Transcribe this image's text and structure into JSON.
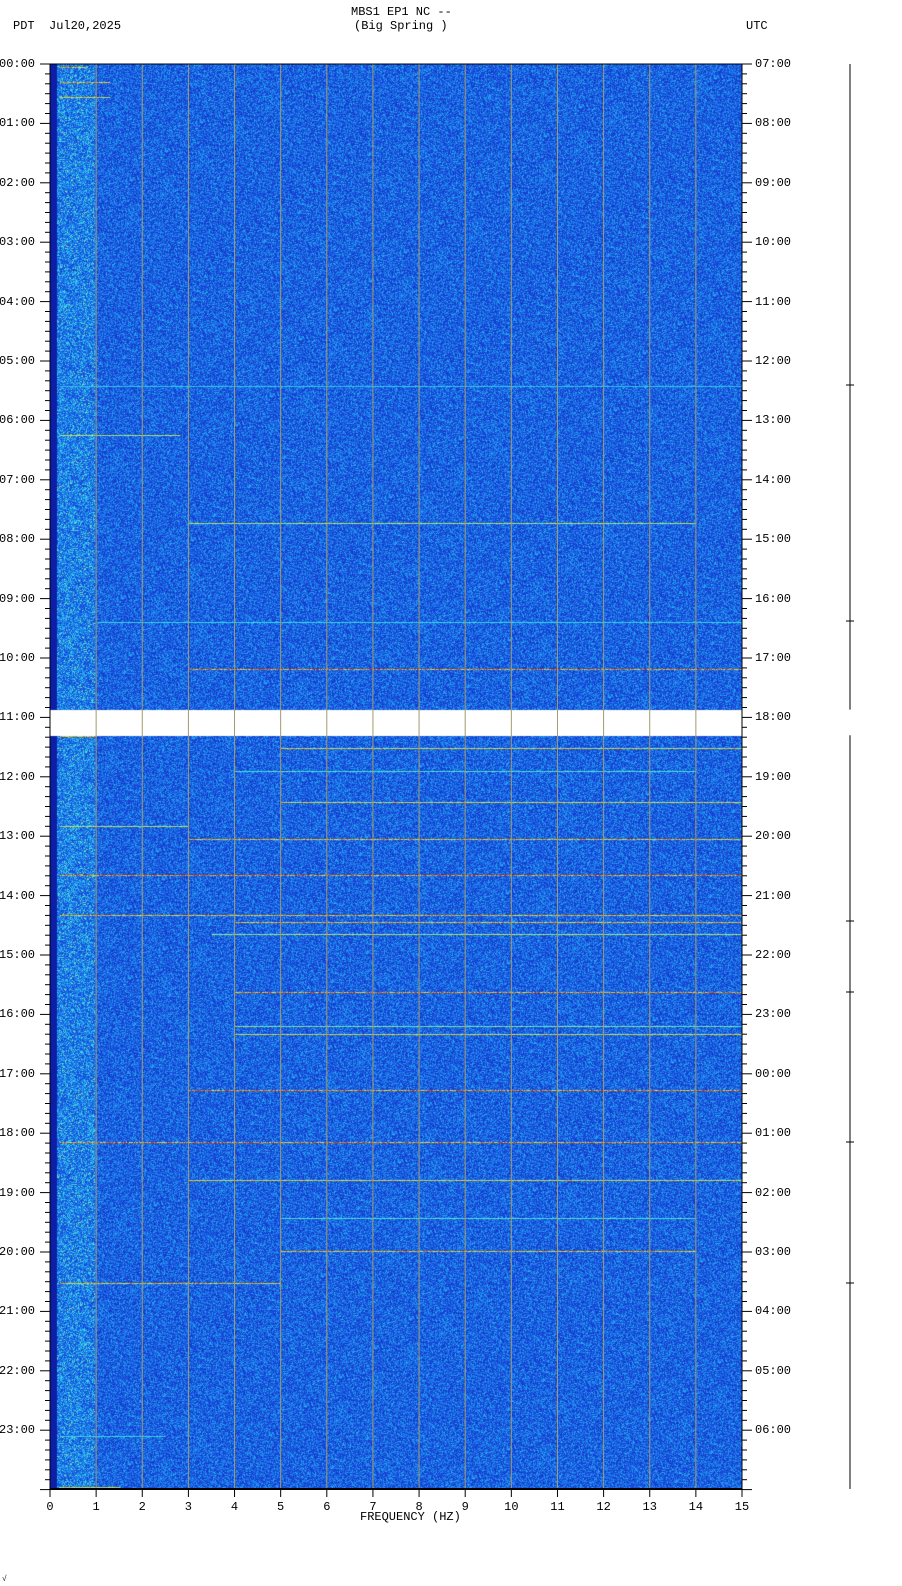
{
  "header": {
    "title": "MBS1 EP1 NC --",
    "subtitle": "(Big Spring )",
    "left_label": "PDT  Jul20,2025",
    "right_label": "UTC"
  },
  "footer_mark": "√",
  "chart_data": {
    "type": "heatmap",
    "title": "MBS1 EP1 NC -- (Big Spring )",
    "xlabel": "FREQUENCY (HZ)",
    "xlim": [
      0,
      15
    ],
    "x_ticks": [
      "0",
      "1",
      "2",
      "3",
      "4",
      "5",
      "6",
      "7",
      "8",
      "9",
      "10",
      "11",
      "12",
      "13",
      "14",
      "15"
    ],
    "ylabel_left": "PDT",
    "ylabel_right": "UTC",
    "ylim_hours": [
      0,
      24
    ],
    "y_ticks_left": [
      "00:00",
      "01:00",
      "02:00",
      "03:00",
      "04:00",
      "05:00",
      "06:00",
      "07:00",
      "08:00",
      "09:00",
      "10:00",
      "11:00",
      "12:00",
      "13:00",
      "14:00",
      "15:00",
      "16:00",
      "17:00",
      "18:00",
      "19:00",
      "20:00",
      "21:00",
      "22:00",
      "23:00"
    ],
    "y_ticks_right": [
      "07:00",
      "08:00",
      "09:00",
      "10:00",
      "11:00",
      "12:00",
      "13:00",
      "14:00",
      "15:00",
      "16:00",
      "17:00",
      "18:00",
      "19:00",
      "20:00",
      "21:00",
      "22:00",
      "23:00",
      "00:00",
      "01:00",
      "02:00",
      "03:00",
      "04:00",
      "05:00",
      "06:00"
    ],
    "data_gap_hours": [
      10.87,
      11.3
    ],
    "colors": {
      "background": "#1a3fd0",
      "noise_high": "#22d0f0",
      "event_high": "#d01010",
      "gap": "#ffffff",
      "grid": "#a09a70"
    },
    "events": [
      {
        "hour": 0.05,
        "fmin": 0.2,
        "fmax": 0.8,
        "intensity": 0.9
      },
      {
        "hour": 0.3,
        "fmin": 0.2,
        "fmax": 1.3,
        "intensity": 0.9
      },
      {
        "hour": 0.55,
        "fmin": 0.2,
        "fmax": 1.3,
        "intensity": 0.8
      },
      {
        "hour": 5.42,
        "fmin": 0.2,
        "fmax": 15,
        "intensity": 0.3
      },
      {
        "hour": 6.25,
        "fmin": 0.2,
        "fmax": 2.8,
        "intensity": 0.7
      },
      {
        "hour": 7.72,
        "fmin": 3,
        "fmax": 14,
        "intensity": 0.7
      },
      {
        "hour": 9.4,
        "fmin": 1,
        "fmax": 15,
        "intensity": 0.4
      },
      {
        "hour": 10.18,
        "fmin": 3,
        "fmax": 15,
        "intensity": 1.0
      },
      {
        "hour": 11.32,
        "fmin": 0.2,
        "fmax": 1,
        "intensity": 0.9
      },
      {
        "hour": 11.52,
        "fmin": 5,
        "fmax": 15,
        "intensity": 0.8
      },
      {
        "hour": 11.9,
        "fmin": 4,
        "fmax": 14,
        "intensity": 0.5
      },
      {
        "hour": 12.43,
        "fmin": 5,
        "fmax": 15,
        "intensity": 0.8
      },
      {
        "hour": 12.82,
        "fmin": 0.2,
        "fmax": 3,
        "intensity": 0.7
      },
      {
        "hour": 13.05,
        "fmin": 3,
        "fmax": 15,
        "intensity": 0.9
      },
      {
        "hour": 13.65,
        "fmin": 0.2,
        "fmax": 15,
        "intensity": 1.0
      },
      {
        "hour": 14.33,
        "fmin": 0.2,
        "fmax": 15,
        "intensity": 0.9
      },
      {
        "hour": 14.45,
        "fmin": 4,
        "fmax": 15,
        "intensity": 0.9
      },
      {
        "hour": 14.65,
        "fmin": 3.5,
        "fmax": 15,
        "intensity": 0.7
      },
      {
        "hour": 15.62,
        "fmin": 4,
        "fmax": 15,
        "intensity": 1.0
      },
      {
        "hour": 16.2,
        "fmin": 4,
        "fmax": 15,
        "intensity": 0.6
      },
      {
        "hour": 16.33,
        "fmin": 4,
        "fmax": 15,
        "intensity": 0.8
      },
      {
        "hour": 17.28,
        "fmin": 3,
        "fmax": 15,
        "intensity": 1.0
      },
      {
        "hour": 18.15,
        "fmin": 0.2,
        "fmax": 15,
        "intensity": 1.0
      },
      {
        "hour": 18.78,
        "fmin": 3,
        "fmax": 15,
        "intensity": 0.8
      },
      {
        "hour": 19.43,
        "fmin": 5,
        "fmax": 14,
        "intensity": 0.5
      },
      {
        "hour": 19.98,
        "fmin": 5,
        "fmax": 14,
        "intensity": 0.9
      },
      {
        "hour": 20.53,
        "fmin": 0.2,
        "fmax": 5,
        "intensity": 0.9
      },
      {
        "hour": 23.1,
        "fmin": 0.2,
        "fmax": 2.5,
        "intensity": 0.4
      },
      {
        "hour": 23.95,
        "fmin": 0.2,
        "fmax": 1.5,
        "intensity": 0.8
      }
    ]
  }
}
